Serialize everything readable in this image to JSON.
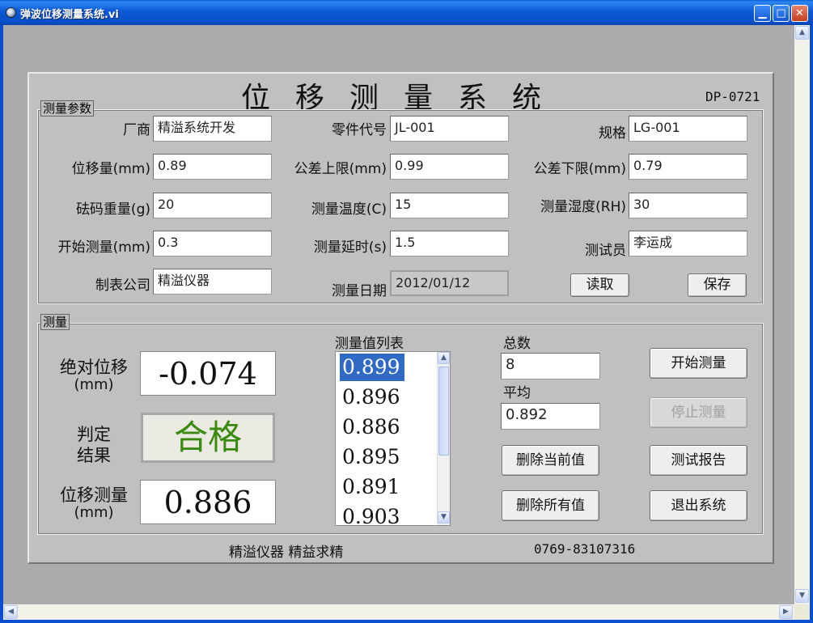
{
  "window": {
    "title": "弹波位移测量系统.vi"
  },
  "header": {
    "title": "位移测量系统",
    "model": "DP-0721"
  },
  "params": {
    "label": "测量参数",
    "fields": [
      {
        "label": "厂商",
        "value": "精溢系统开发"
      },
      {
        "label": "零件代号",
        "value": "JL-001"
      },
      {
        "label": "规格",
        "value": "LG-001"
      },
      {
        "label": "位移量(mm)",
        "value": "0.89"
      },
      {
        "label": "公差上限(mm)",
        "value": "0.99"
      },
      {
        "label": "公差下限(mm)",
        "value": "0.79"
      },
      {
        "label": "砝码重量(g)",
        "value": "20"
      },
      {
        "label": "测量温度(C)",
        "value": "15"
      },
      {
        "label": "测量湿度(RH)",
        "value": "30"
      },
      {
        "label": "开始测量(mm)",
        "value": "0.3"
      },
      {
        "label": "测量延时(s)",
        "value": "1.5"
      },
      {
        "label": "测试员",
        "value": "李运成"
      },
      {
        "label": "制表公司",
        "value": "精溢仪器"
      },
      {
        "label": "测量日期",
        "value": "2012/01/12"
      }
    ],
    "read_button": "读取",
    "save_button": "保存"
  },
  "measure": {
    "label": "测量",
    "abs_label": "绝对位移",
    "abs_unit": "(mm)",
    "abs_value": "-0.074",
    "judge_label_1": "判定",
    "judge_label_2": "结果",
    "judge_value": "合格",
    "disp_label": "位移测量",
    "disp_unit": "(mm)",
    "disp_value": "0.886",
    "list_label": "测量值列表",
    "list_items": [
      "0.899",
      "0.896",
      "0.886",
      "0.895",
      "0.891",
      "0.903"
    ],
    "total_label": "总数",
    "total_value": "8",
    "avg_label": "平均",
    "avg_value": "0.892",
    "delete_current": "删除当前值",
    "delete_all": "删除所有值",
    "start_button": "开始测量",
    "stop_button": "停止测量",
    "report_button": "测试报告",
    "exit_button": "退出系统"
  },
  "footer": {
    "company": "精溢仪器 精益求精",
    "phone": "0769-83107316"
  },
  "colors": {
    "titlebar": "#0a58d0",
    "panel": "#c0c0c0",
    "client": "#ababab",
    "pass_green": "#3a8a10",
    "selection": "#316ac5"
  },
  "icons": {
    "app": "app-icon",
    "minimize": "minimize-icon",
    "maximize": "maximize-icon",
    "close": "close-icon"
  }
}
